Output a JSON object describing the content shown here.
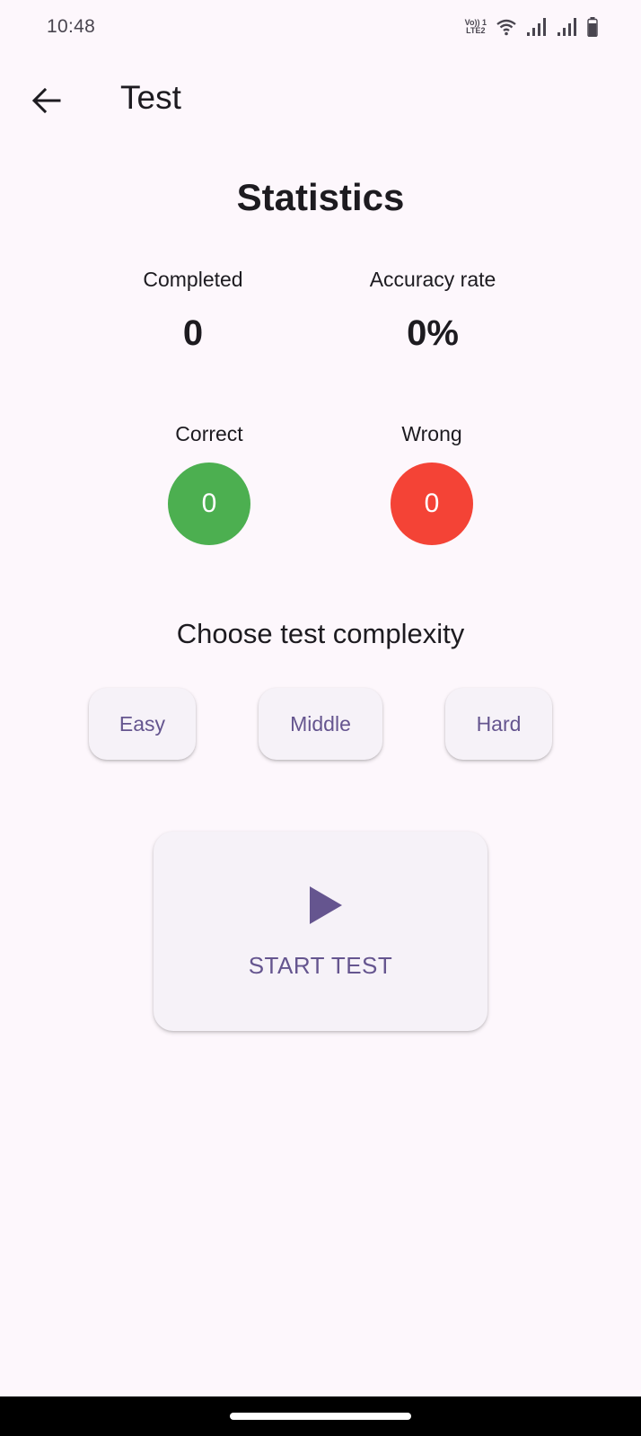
{
  "status_bar": {
    "time": "10:48",
    "volte_top": "Vo)) 1",
    "volte_bottom": "LTE2",
    "icons": [
      "volte-icon",
      "wifi-icon",
      "signal-icon",
      "signal-icon",
      "battery-icon"
    ]
  },
  "app_bar": {
    "back_icon": "arrow-back-icon",
    "title": "Test"
  },
  "statistics": {
    "title": "Statistics",
    "completed_label": "Completed",
    "completed_value": "0",
    "accuracy_label": "Accuracy rate",
    "accuracy_value": "0%",
    "correct_label": "Correct",
    "correct_value": "0",
    "wrong_label": "Wrong",
    "wrong_value": "0"
  },
  "complexity": {
    "title": "Choose test complexity",
    "levels": [
      "Easy",
      "Middle",
      "Hard"
    ]
  },
  "start": {
    "icon": "play-icon",
    "label": "START TEST"
  },
  "colors": {
    "background": "#fdf7fc",
    "correct": "#4caf50",
    "wrong": "#f44336",
    "accent": "#65558f"
  }
}
